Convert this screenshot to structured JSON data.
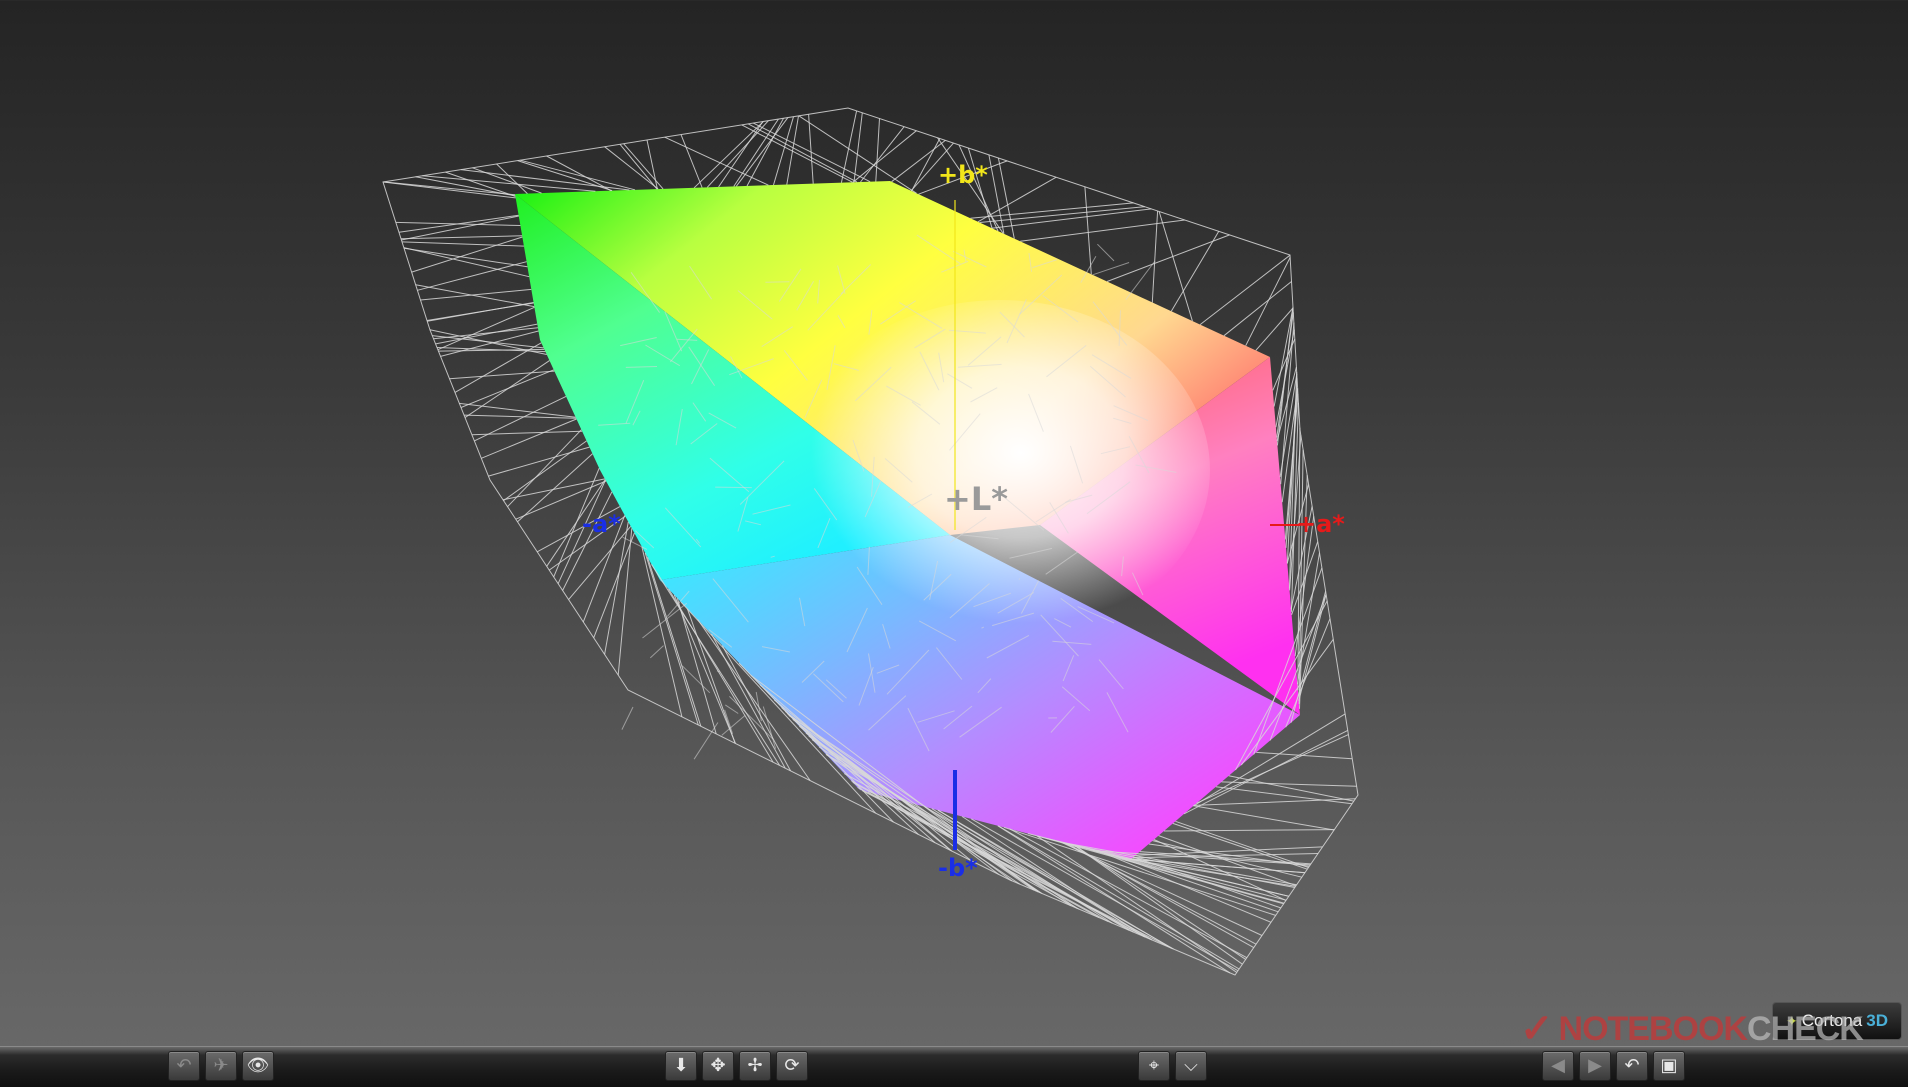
{
  "viewer": {
    "axis_labels": {
      "b_plus": "+b*",
      "b_minus": "-b*",
      "a_plus": "+a*",
      "a_minus": "-a*",
      "l_plus": "+L*"
    },
    "colors": {
      "b_plus": "#f2e61a",
      "b_minus": "#1a2ee6",
      "a_plus": "#e61a1a",
      "a_minus": "#1a2ee6",
      "l_plus": "#9a9a9a",
      "wireframe": "#d8d8d8"
    }
  },
  "toolbar": {
    "left_buttons": [
      {
        "name": "restore-view-icon",
        "glyph": "↶",
        "state": "disabled"
      },
      {
        "name": "fly-icon",
        "glyph": "✈",
        "state": "disabled"
      },
      {
        "name": "view-icon",
        "glyph": "👁",
        "state": "enabled"
      }
    ],
    "center_buttons": [
      {
        "name": "walk-icon",
        "glyph": "⬇",
        "state": "enabled"
      },
      {
        "name": "pan-icon",
        "glyph": "✥",
        "state": "enabled"
      },
      {
        "name": "rotate-icon",
        "glyph": "✢",
        "state": "enabled"
      },
      {
        "name": "study-icon",
        "glyph": "⟳",
        "state": "enabled"
      }
    ],
    "middle_buttons": [
      {
        "name": "goto-icon",
        "glyph": "⌖",
        "state": "enabled"
      },
      {
        "name": "align-icon",
        "glyph": "⌵",
        "state": "enabled"
      }
    ],
    "right_buttons": [
      {
        "name": "previous-viewpoint-icon",
        "glyph": "◀",
        "state": "disabled"
      },
      {
        "name": "next-viewpoint-icon",
        "glyph": "▶",
        "state": "disabled"
      },
      {
        "name": "undo-move-icon",
        "glyph": "↶",
        "state": "enabled"
      },
      {
        "name": "fit-icon",
        "glyph": "▣",
        "state": "enabled"
      }
    ]
  },
  "badge": {
    "logo": "Cortona",
    "version": "3D"
  },
  "watermark": {
    "part1": "NOTEBOOK",
    "part2": "CHECK"
  }
}
